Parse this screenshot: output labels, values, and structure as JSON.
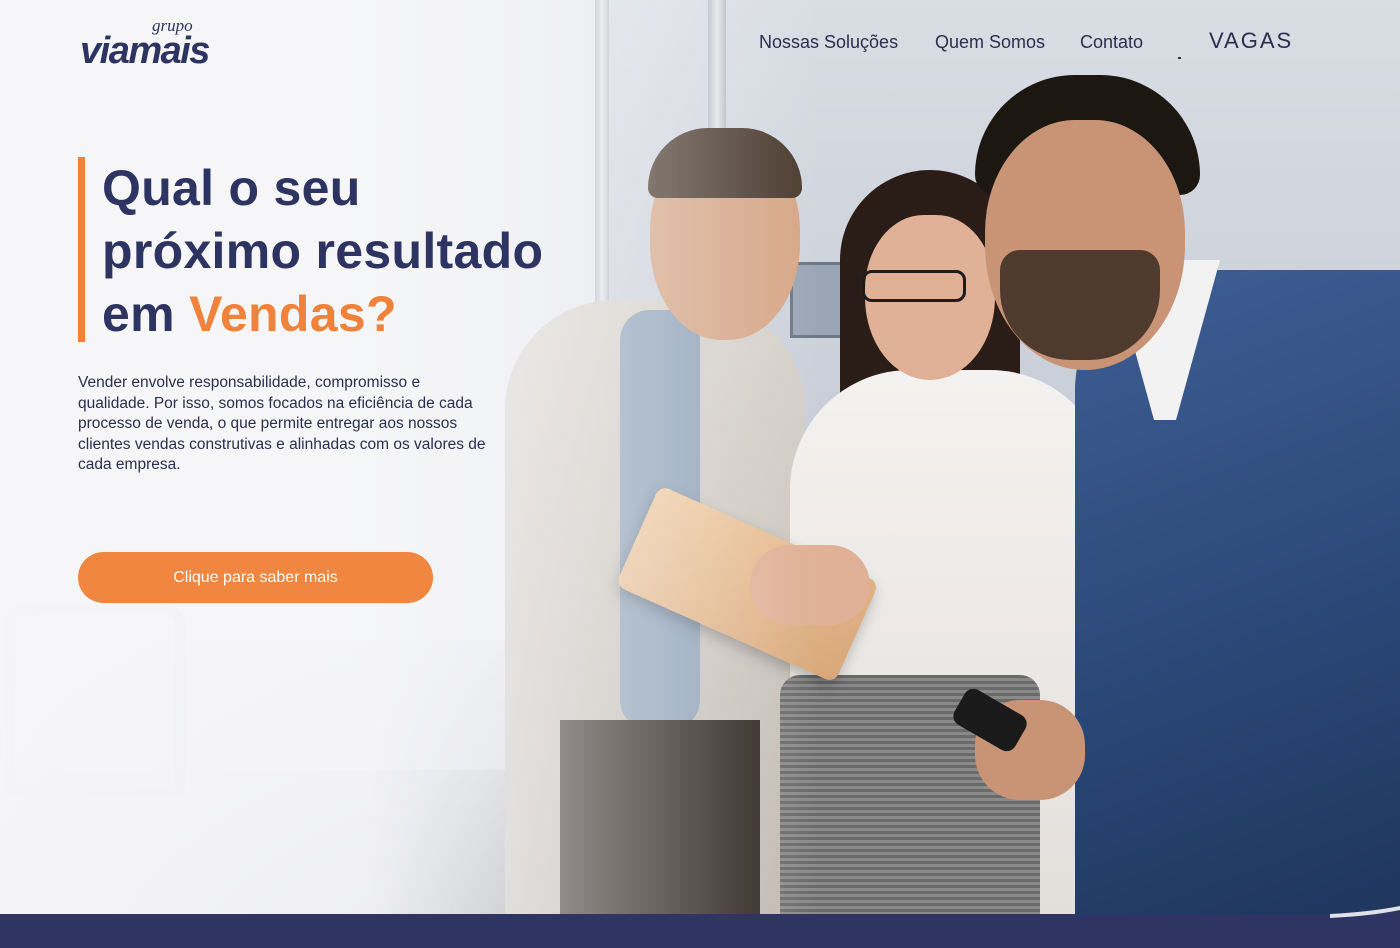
{
  "brand": {
    "logo_prefix": "grupo",
    "logo_name": "viamais"
  },
  "nav": {
    "items": [
      {
        "label": "Nossas Soluções"
      },
      {
        "label": "Quem Somos"
      },
      {
        "label": "Contato"
      }
    ],
    "vagas_label": "VAGAS"
  },
  "hero": {
    "headline_line1": "Qual o seu",
    "headline_line2": "próximo resultado",
    "headline_line3_prefix": "em ",
    "headline_line3_accent": "Vendas?",
    "body": "Vender envolve responsabilidade, compromisso e qualidade. Por isso, somos focados na eficiência de cada processo de venda, o que permite entregar aos nossos clientes vendas construtivas e alinhadas com os valores de cada empresa.",
    "cta_label": "Clique para saber mais"
  },
  "colors": {
    "brand_navy": "#2e3462",
    "accent_orange": "#f0823b",
    "footer_band": "#2f3563"
  }
}
